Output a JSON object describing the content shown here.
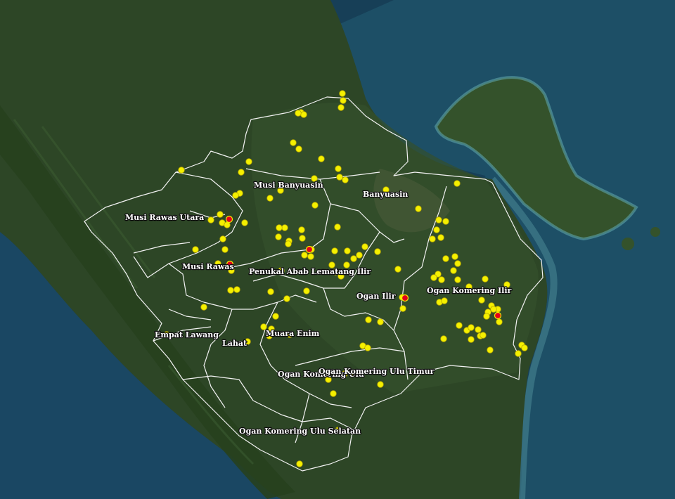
{
  "map": {
    "basemap": "satellite imagery",
    "colors": {
      "hotspot_fill": "#f5f000",
      "hotspot_stroke": "#b8a800",
      "hotspot_high_fill": "#e4001a",
      "boundary": "#f2f2f2",
      "land": "#2d4626",
      "sea": "#173f57",
      "coast_shallow": "#4b8a95"
    }
  },
  "regions": [
    {
      "id": "musi-rawas-utara",
      "label": "Musi Rawas Utara"
    },
    {
      "id": "musi-banyuasin",
      "label": "Musi Banyuasin"
    },
    {
      "id": "banyuasin",
      "label": "Banyuasin"
    },
    {
      "id": "musi-rawas",
      "label": "Musi Rawas"
    },
    {
      "id": "pali",
      "label": "Penukal Abab Lematang Ilir"
    },
    {
      "id": "ogan-komering-ilir",
      "label": "Ogan Komering Ilir"
    },
    {
      "id": "ogan-ilir",
      "label": "Ogan Ilir"
    },
    {
      "id": "empat-lawang",
      "label": "Empat Lawang"
    },
    {
      "id": "muara-enim",
      "label": "Muara Enim"
    },
    {
      "id": "lahat",
      "label": "Lahat"
    },
    {
      "id": "oku",
      "label": "Ogan Komering Ulu"
    },
    {
      "id": "oku-timur",
      "label": "Ogan Komering Ulu Timur"
    },
    {
      "id": "oku-selatan",
      "label": "Ogan Komering Ulu Selatan"
    }
  ]
}
